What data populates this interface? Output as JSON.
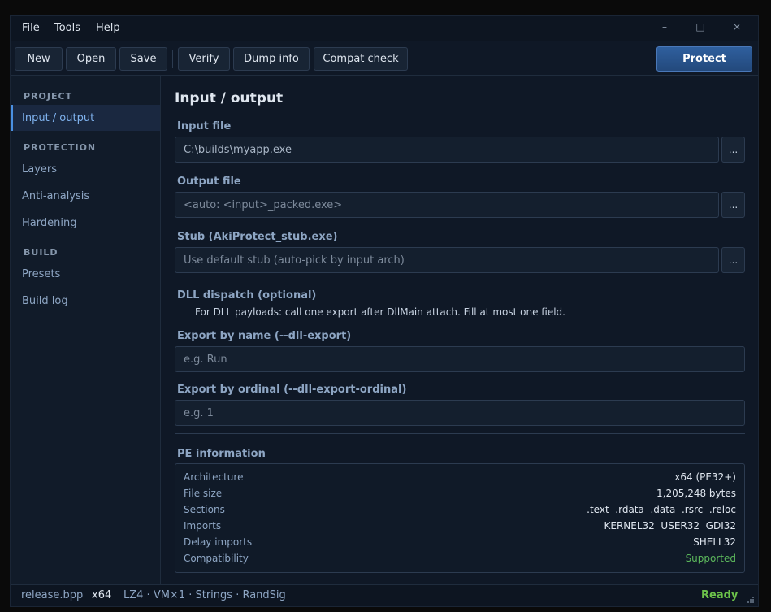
{
  "menu": {
    "file": "File",
    "tools": "Tools",
    "help": "Help"
  },
  "window_controls": {
    "minimize": "–",
    "maximize": "□",
    "close": "×"
  },
  "toolbar": {
    "new": "New",
    "open": "Open",
    "save": "Save",
    "verify": "Verify",
    "dump_info": "Dump info",
    "compat_check": "Compat check",
    "protect": "Protect"
  },
  "sidebar": {
    "project_header": "PROJECT",
    "input_output": "Input / output",
    "protection_header": "PROTECTION",
    "layers": "Layers",
    "anti_analysis": "Anti-analysis",
    "hardening": "Hardening",
    "build_header": "BUILD",
    "presets": "Presets",
    "build_log": "Build log"
  },
  "main": {
    "title": "Input / output",
    "input_file": {
      "label": "Input file",
      "value": "C:\\builds\\myapp.exe",
      "browse": "..."
    },
    "output_file": {
      "label": "Output file",
      "placeholder": "<auto: <input>_packed.exe>",
      "browse": "..."
    },
    "stub": {
      "label": "Stub (AkiProtect_stub.exe)",
      "placeholder": "Use default stub (auto-pick by input arch)",
      "browse": "..."
    },
    "dll_dispatch": {
      "label": "DLL dispatch (optional)",
      "hint": "For DLL payloads: call one export after DllMain attach. Fill at most one field."
    },
    "export_name": {
      "label": "Export by name (--dll-export)",
      "placeholder": "e.g. Run"
    },
    "export_ordinal": {
      "label": "Export by ordinal (--dll-export-ordinal)",
      "placeholder": "e.g. 1"
    },
    "pe_info": {
      "label": "PE information",
      "rows": [
        {
          "key": "Architecture",
          "value": "x64 (PE32+)"
        },
        {
          "key": "File size",
          "value": "1,205,248 bytes"
        },
        {
          "key": "Sections",
          "value": ".text  .rdata  .data  .rsrc  .reloc"
        },
        {
          "key": "Imports",
          "value": "KERNEL32  USER32  GDI32"
        },
        {
          "key": "Delay imports",
          "value": "SHELL32"
        },
        {
          "key": "Compatibility",
          "value": "Supported"
        }
      ]
    }
  },
  "statusbar": {
    "project_file": "release.bpp",
    "arch": "x64",
    "summary": "LZ4 · VM×1 · Strings · RandSig",
    "status": "Ready"
  },
  "colors": {
    "accent": "#4a90e2",
    "protect_button": "#2f5f9e",
    "supported": "#5cb85c",
    "ready": "#6cc24a"
  }
}
